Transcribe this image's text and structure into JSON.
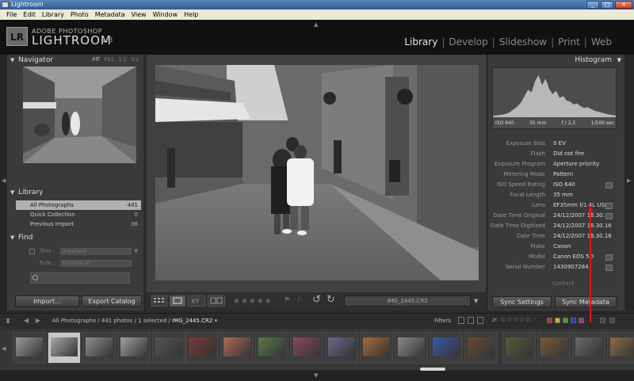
{
  "window": {
    "title": "Lightroom",
    "minimize": "_",
    "maximize": "□",
    "close": "✕"
  },
  "menu": [
    "File",
    "Edit",
    "Library",
    "Photo",
    "Metadata",
    "View",
    "Window",
    "Help"
  ],
  "identity": {
    "badge": "LR",
    "top": "ADOBE PHOTOSHOP",
    "name": "LIGHTROOM",
    "version": "1.3"
  },
  "modules": [
    "Library",
    "Develop",
    "Slideshow",
    "Print",
    "Web"
  ],
  "navigator": {
    "title": "Navigator",
    "zoom": [
      "FIT",
      "FILL",
      "1:1",
      "3:1"
    ]
  },
  "library": {
    "title": "Library",
    "items": [
      {
        "label": "All Photographs",
        "count": "441"
      },
      {
        "label": "Quick Collection",
        "count": "0"
      },
      {
        "label": "Previous Import",
        "count": "38"
      }
    ]
  },
  "find": {
    "title": "Find",
    "text_label": "Text :",
    "text_value": "Anywhere",
    "rule_label": "Rule :",
    "rule_value": "Contains All"
  },
  "left_buttons": {
    "import": "Import...",
    "export": "Export Catalog"
  },
  "toolbar": {
    "filename": "IMG_2445.CR2",
    "stars": "★★★★★"
  },
  "histogram": {
    "title": "Histogram",
    "iso": "ISO 640",
    "focal": "35 mm",
    "aperture": "f / 2,5",
    "shutter": "1/500 sec",
    "levels": [
      0.03,
      0.04,
      0.05,
      0.06,
      0.08,
      0.12,
      0.18,
      0.24,
      0.32,
      0.46,
      0.6,
      0.54,
      0.78,
      0.92,
      0.7,
      0.84,
      0.62,
      0.5,
      0.58,
      0.42,
      0.46,
      0.36,
      0.34,
      0.28,
      0.3,
      0.24,
      0.2,
      0.22,
      0.18,
      0.14,
      0.12,
      0.1,
      0.08,
      0.06,
      0.05,
      0.04
    ]
  },
  "metadata": [
    {
      "key": "Exposure Bias",
      "value": "0 EV"
    },
    {
      "key": "Flash",
      "value": "Did not fire"
    },
    {
      "key": "Exposure Program",
      "value": "Aperture priority"
    },
    {
      "key": "Metering Mode",
      "value": "Pattern"
    },
    {
      "key": "ISO Speed Rating",
      "value": "ISO 640"
    },
    {
      "key": "Focal Length",
      "value": "35 mm"
    },
    {
      "key": "Lens",
      "value": "EF35mm f/1.4L USM"
    },
    {
      "key": "Date Time Original",
      "value": "24/12/2007 16.30.16"
    },
    {
      "key": "Date Time Digitized",
      "value": "24/12/2007 16.30.16"
    },
    {
      "key": "Date Time",
      "value": "24/12/2007 16.30.16"
    },
    {
      "key": "Make",
      "value": "Canon"
    },
    {
      "key": "Model",
      "value": "Canon EOS 5D"
    },
    {
      "key": "Serial Number",
      "value": "1430907284"
    }
  ],
  "contact": "Contact",
  "right_buttons": {
    "sync_settings": "Sync Settings",
    "sync_metadata": "Sync Metadata"
  },
  "filmstrip": {
    "source": "All Photographs / 441 photos / 1 selected /",
    "current": "IMG_2445.CR2",
    "filters_label": "Filters",
    "stars": "≥ ☆☆☆☆☆"
  },
  "colors": {
    "accent_arrow": "#e0171a",
    "selected_row": "#b0b0b0"
  }
}
